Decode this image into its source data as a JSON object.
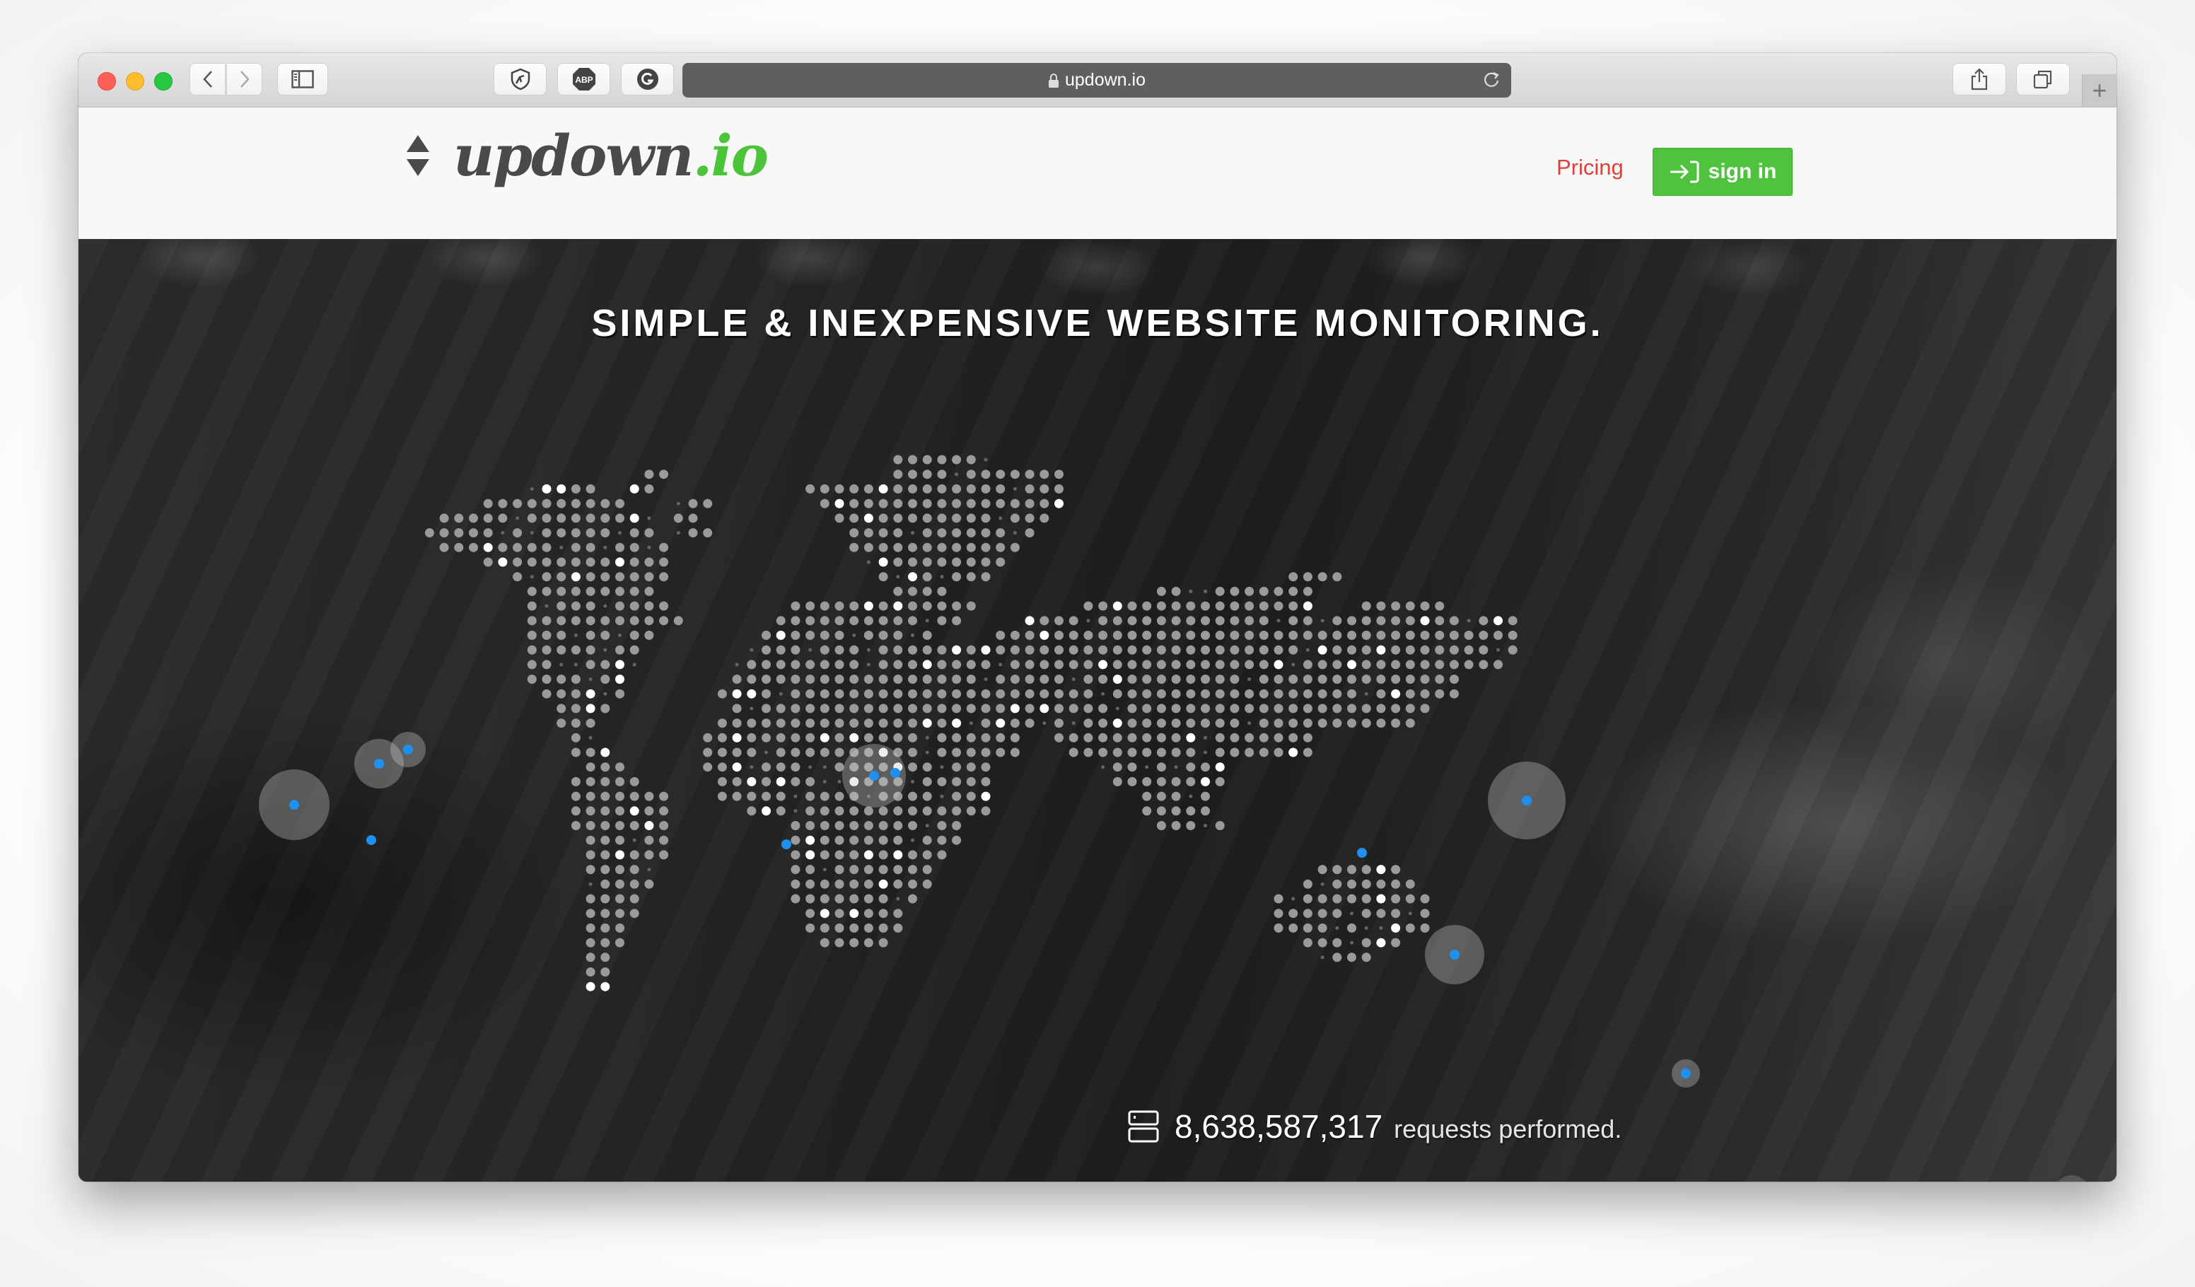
{
  "browser": {
    "url": "updown.io",
    "extensions": [
      "privacy-badger-icon",
      "adblock-plus-icon",
      "grammarly-icon"
    ],
    "adblock_label": "ABP"
  },
  "header": {
    "logo_main": "updown",
    "logo_tld": ".io",
    "pricing_label": "Pricing",
    "signin_label": "sign in"
  },
  "hero": {
    "tagline": "SIMPLE & INEXPENSIVE WEBSITE MONITORING.",
    "requests_count": "8,638,587,317",
    "requests_label": "requests performed."
  },
  "colors": {
    "brand_green": "#4fc33d",
    "pricing_red": "#e0403a",
    "marker_blue": "#1e90f0",
    "map_dot": "#9a9a9a",
    "map_dot_active": "#ffffff"
  },
  "help": {
    "label": "?"
  }
}
